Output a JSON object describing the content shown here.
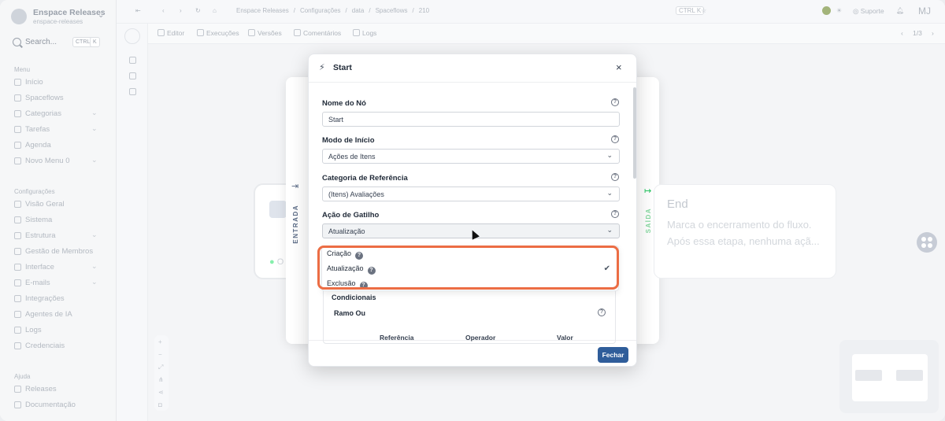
{
  "workspace": {
    "name": "Enspace Releases",
    "sub": "enspace-releases"
  },
  "search": {
    "label": "Search...",
    "kbd1": "CTRL",
    "kbd2": "K"
  },
  "sidebar": {
    "menu_title": "Menu",
    "menu": [
      {
        "label": "Início",
        "chev": false
      },
      {
        "label": "Spaceflows",
        "chev": false
      },
      {
        "label": "Categorias",
        "chev": true
      },
      {
        "label": "Tarefas",
        "chev": true
      },
      {
        "label": "Agenda",
        "chev": false
      },
      {
        "label": "Novo Menu 0",
        "chev": true
      }
    ],
    "config_title": "Configurações",
    "config": [
      {
        "label": "Visão Geral",
        "chev": false
      },
      {
        "label": "Sistema",
        "chev": false
      },
      {
        "label": "Estrutura",
        "chev": true
      },
      {
        "label": "Gestão de Membros",
        "chev": false
      },
      {
        "label": "Interface",
        "chev": true
      },
      {
        "label": "E-mails",
        "chev": true
      },
      {
        "label": "Integrações",
        "chev": false
      },
      {
        "label": "Agentes de IA",
        "chev": false
      },
      {
        "label": "Logs",
        "chev": false
      },
      {
        "label": "Credenciais",
        "chev": false
      }
    ],
    "help_title": "Ajuda",
    "help": [
      {
        "label": "Releases",
        "chev": false
      },
      {
        "label": "Documentação",
        "chev": false
      }
    ],
    "chevron": "⌄"
  },
  "breadcrumb": {
    "items": [
      "Enspace Releases",
      "/",
      "Configurações",
      "/",
      "data",
      "/",
      "Spaceflows",
      "/",
      "210"
    ]
  },
  "topbar": {
    "ctrl": "CTRL",
    "k": "K",
    "suporte": "Suporte",
    "avatar": "MJ"
  },
  "toolbar": {
    "tabs": [
      "Editor",
      "Execuções",
      "Versões",
      "Comentários",
      "Logs"
    ],
    "pager": "1/3"
  },
  "canvas": {
    "entrada": "ENTRADA",
    "saida": "SAÍDA",
    "end_title": "End",
    "end_desc": "Marca o encerramento do fluxo. Após essa etapa, nenhuma açã...",
    "start_dot": "O"
  },
  "modal": {
    "title": "Start",
    "close": "×",
    "fields": [
      {
        "label": "Nome do Nó",
        "value": "Start"
      },
      {
        "label": "Modo de Início",
        "value": "Ações de Itens"
      },
      {
        "label": "Categoria de Referência",
        "value": "(Itens) Avaliações"
      },
      {
        "label": "Ação de Gatilho",
        "value": "Atualização"
      }
    ],
    "dropdown": [
      {
        "label": "Criação",
        "selected": false
      },
      {
        "label": "Atualização",
        "selected": true
      },
      {
        "label": "Exclusão",
        "selected": false
      }
    ],
    "condicionais": "Condicionais",
    "ramo": "Ramo Ou",
    "columns": [
      "Referência",
      "Operador",
      "Valor"
    ],
    "close_button": "Fechar"
  },
  "colors": {
    "accent": "#2f5d9a",
    "highlight": "#ec6d44",
    "entrada": "#5b6b86",
    "saida": "#22c55e"
  }
}
